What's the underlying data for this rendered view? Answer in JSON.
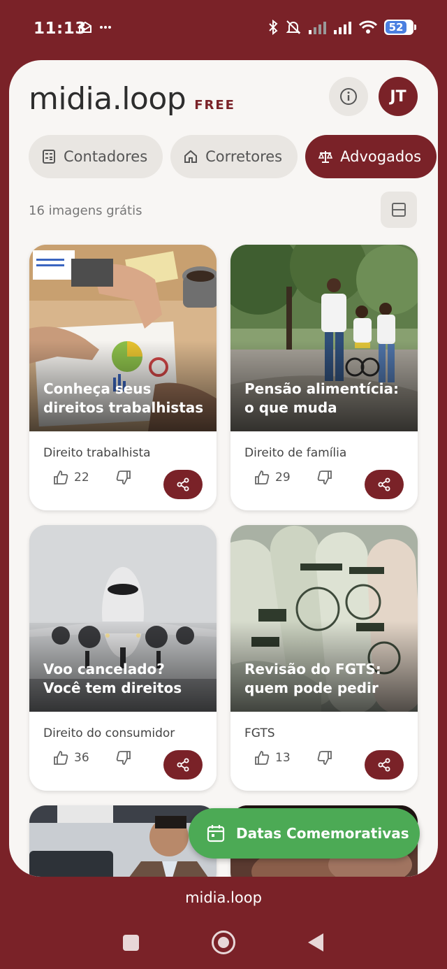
{
  "status_bar": {
    "time": "11:13",
    "battery": "52"
  },
  "header": {
    "logo": "midia.loop",
    "plan_badge": "FREE",
    "avatar_initials": "JT"
  },
  "tabs": [
    {
      "label": "Contadores",
      "icon": "calculator-icon",
      "active": false
    },
    {
      "label": "Corretores",
      "icon": "home-icon",
      "active": false
    },
    {
      "label": "Advogados",
      "icon": "scales-icon",
      "active": true
    }
  ],
  "gallery": {
    "count_text": "16 imagens grátis",
    "posts": [
      {
        "title": "Conheça seus direitos trabalhistas",
        "category": "Direito trabalhista",
        "likes": "22"
      },
      {
        "title": "Pensão alimentícia: o que muda",
        "category": "Direito de família",
        "likes": "29"
      },
      {
        "title": "Voo cancelado? Você tem direitos",
        "category": "Direito do consumidor",
        "likes": "36"
      },
      {
        "title": "Revisão do FGTS: quem pode pedir",
        "category": "FGTS",
        "likes": "13"
      }
    ]
  },
  "fab": {
    "label": "Datas Comemorativas",
    "icon": "calendar-icon"
  },
  "footer": {
    "brand": "midia.loop"
  },
  "colors": {
    "brand": "#7a2228",
    "fab": "#4caa55",
    "background": "#f8f6f4"
  }
}
